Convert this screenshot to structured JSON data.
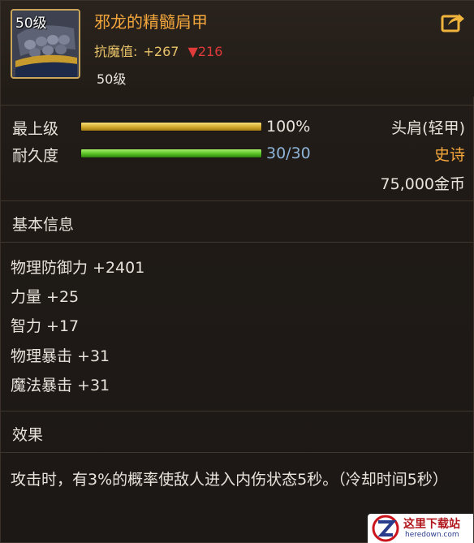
{
  "item": {
    "level_badge": "50级",
    "name": "邪龙的精髓肩甲",
    "resist_label": "抗魔值:",
    "resist_value": "+267",
    "resist_down_arrow": "▼",
    "resist_down_value": "216",
    "level_requirement": "50级",
    "icon": "shoulder-armor-icon"
  },
  "stats": {
    "max_level_label": "最上级",
    "max_level_percent": 100,
    "max_level_text": "100%",
    "durability_label": "耐久度",
    "durability_current": 30,
    "durability_max": 30,
    "durability_text": "30/30",
    "slot_type": "头肩(轻甲)",
    "rarity": "史诗",
    "price": "75,000金币"
  },
  "basic_info": {
    "title": "基本信息",
    "lines": [
      "物理防御力 +2401",
      "力量 +25",
      "智力 +17",
      "物理暴击 +31",
      "魔法暴击 +31"
    ]
  },
  "effect": {
    "title": "效果",
    "text": "攻击时，有3%的概率使敌人进入内伤状态5秒。（冷却时间5秒）"
  },
  "watermark": {
    "main": "这里下载站",
    "sub": "heredown.com"
  },
  "colors": {
    "name_orange": "#f3a63c",
    "resist_gold": "#e9c46a",
    "down_red": "#e03b3b",
    "rarity_orange": "#f3a63c",
    "durability_blue": "#8fb4d8",
    "bar_gold": "#d4aa2c",
    "bar_green": "#57c223"
  }
}
